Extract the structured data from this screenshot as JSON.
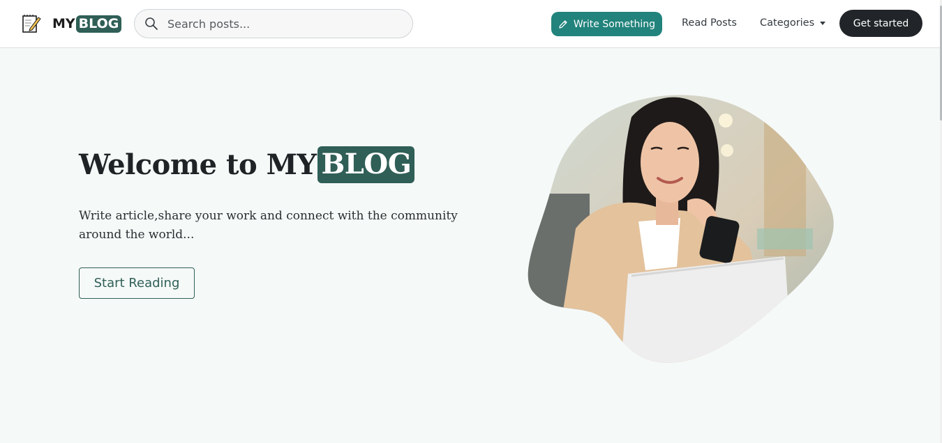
{
  "brand": {
    "prefix": "MY",
    "highlight": "BLOG",
    "icon": "notepad-pencil-icon"
  },
  "search": {
    "placeholder": "Search posts...",
    "value": "",
    "icon": "search-icon"
  },
  "nav": {
    "write_label": "Write Something",
    "write_icon": "pencil-icon",
    "read_label": "Read Posts",
    "categories_label": "Categories",
    "get_started_label": "Get started"
  },
  "hero": {
    "title_prefix": "Welcome to MY",
    "title_highlight": "BLOG",
    "subtitle": "Write article,share your work and connect with the community around the world...",
    "cta_label": "Start Reading",
    "image": "woman-smiling-at-phone-photo"
  },
  "colors": {
    "accent": "#2f5f56",
    "write_button": "#21837c",
    "dark_button": "#212529",
    "hero_background": "#f5f9f8"
  }
}
